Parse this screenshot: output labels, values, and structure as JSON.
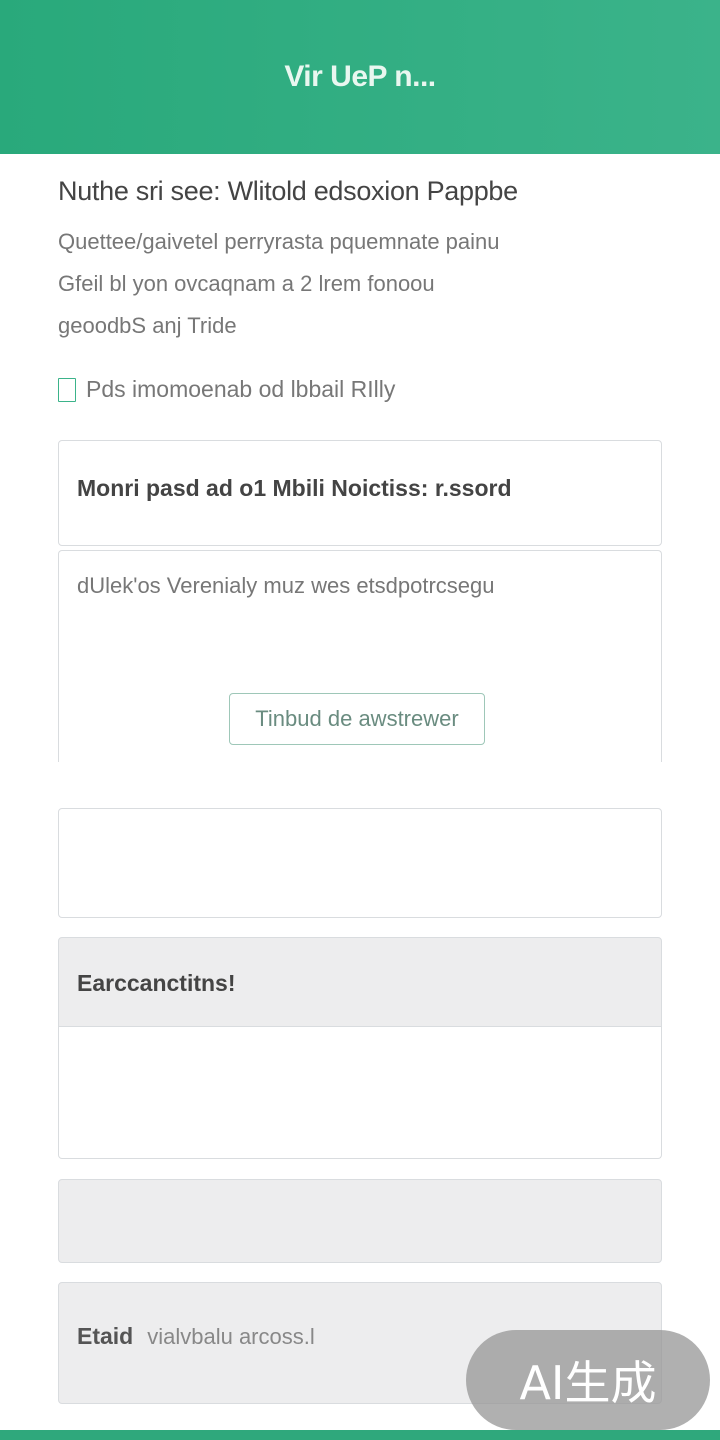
{
  "header": {
    "title": "Vir UeP n...",
    "color": "#2fae80"
  },
  "intro": {
    "title": "Nuthe sri see: Wlitold edsoxion Pappbe",
    "lines": [
      "Quettee/gaivetel perryrasta pquemnate painu",
      "Gfeil bl yon ovcaqnam a 2 lrem fonoou",
      "geoodbS anj Tride"
    ]
  },
  "checkbox": {
    "label": "Pds imomoenab od lbbail RIlly"
  },
  "card1": {
    "title": "Monri pasd ad o1 Mbili Noictiss: r.ssord"
  },
  "card2": {
    "text": "dUlek'os Verenialy muz wes etsdpotrcsegu",
    "button_label": "Tinbud de awstrewer"
  },
  "card4": {
    "title": "Earccanctitns!"
  },
  "card6": {
    "label": "Etaid",
    "value": "vialvbalu arcoss.l"
  },
  "watermark": "AI生成"
}
